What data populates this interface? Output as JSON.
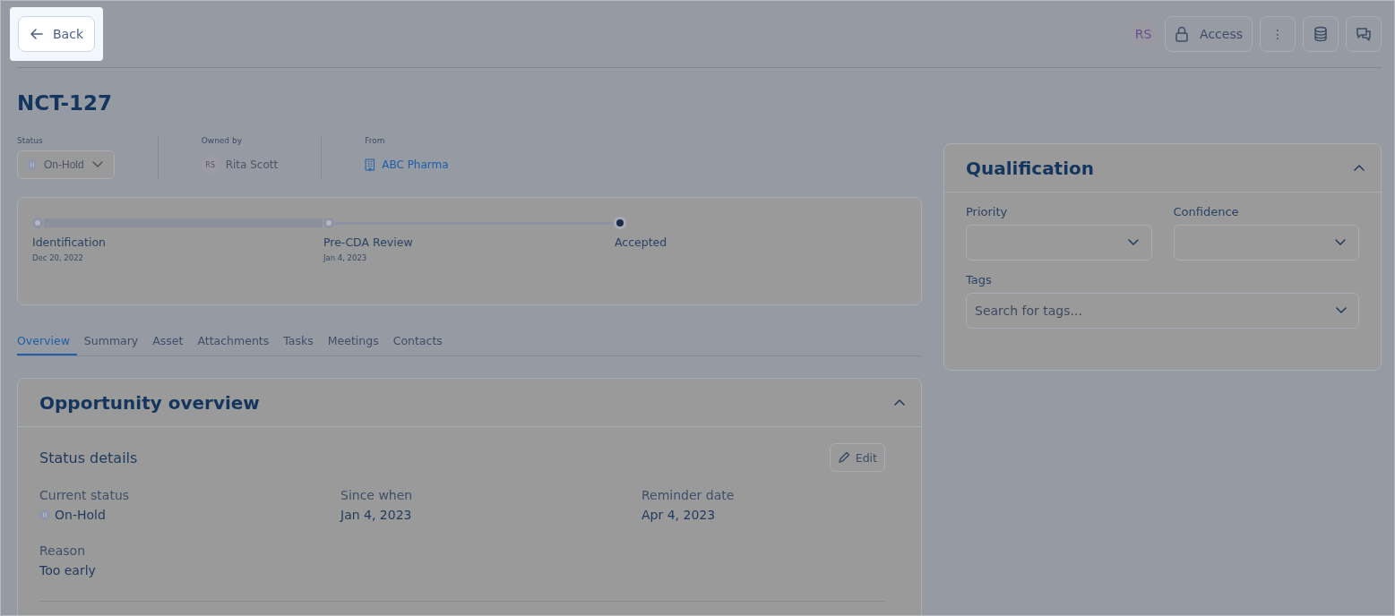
{
  "header": {
    "back_label": "Back",
    "avatar": "RS",
    "access_label": "Access",
    "more_label": "⋮"
  },
  "record": {
    "title": "NCT-127",
    "meta": [
      {
        "kind": "status",
        "label": "Status",
        "value": "On-Hold"
      },
      {
        "kind": "owner",
        "label": "Owned by",
        "initials": "RS",
        "value": "Rita Scott"
      },
      {
        "kind": "link",
        "label": "From",
        "value": "ABC Pharma"
      }
    ]
  },
  "stepper": [
    {
      "name": "Identification",
      "date": "Dec 20, 2022",
      "completed": true,
      "current": false
    },
    {
      "name": "Pre-CDA Review",
      "date": "Jan 4, 2023",
      "completed": true,
      "current": false
    },
    {
      "name": "Accepted",
      "completed": false,
      "current": true
    }
  ],
  "tabs": [
    {
      "label": "Overview",
      "selected": true
    },
    {
      "label": "Summary",
      "selected": false
    },
    {
      "label": "Asset",
      "selected": false
    },
    {
      "label": "Attachments",
      "selected": false
    },
    {
      "label": "Tasks",
      "selected": false
    },
    {
      "label": "Meetings",
      "selected": false
    },
    {
      "label": "Contacts",
      "selected": false
    }
  ],
  "overview": {
    "title": "Opportunity overview",
    "expanded": true,
    "section": "Status details",
    "edit_label": "Edit",
    "fields": [
      {
        "kind": "status",
        "label": "Current status",
        "value": "On-Hold"
      },
      {
        "kind": "text",
        "label": "Since when",
        "value": "Jan 4, 2023"
      },
      {
        "kind": "text",
        "label": "Reminder date",
        "value": "Apr 4, 2023"
      },
      {
        "kind": "text",
        "label": "Reason",
        "value": "Too early"
      }
    ]
  },
  "qualification": {
    "title": "Qualification",
    "expanded": true,
    "fields": [
      {
        "label": "Priority",
        "kind": "select"
      },
      {
        "label": "Confidence",
        "kind": "select"
      },
      {
        "label": "Tags",
        "kind": "search",
        "placeholder": "Search for tags..."
      }
    ]
  }
}
